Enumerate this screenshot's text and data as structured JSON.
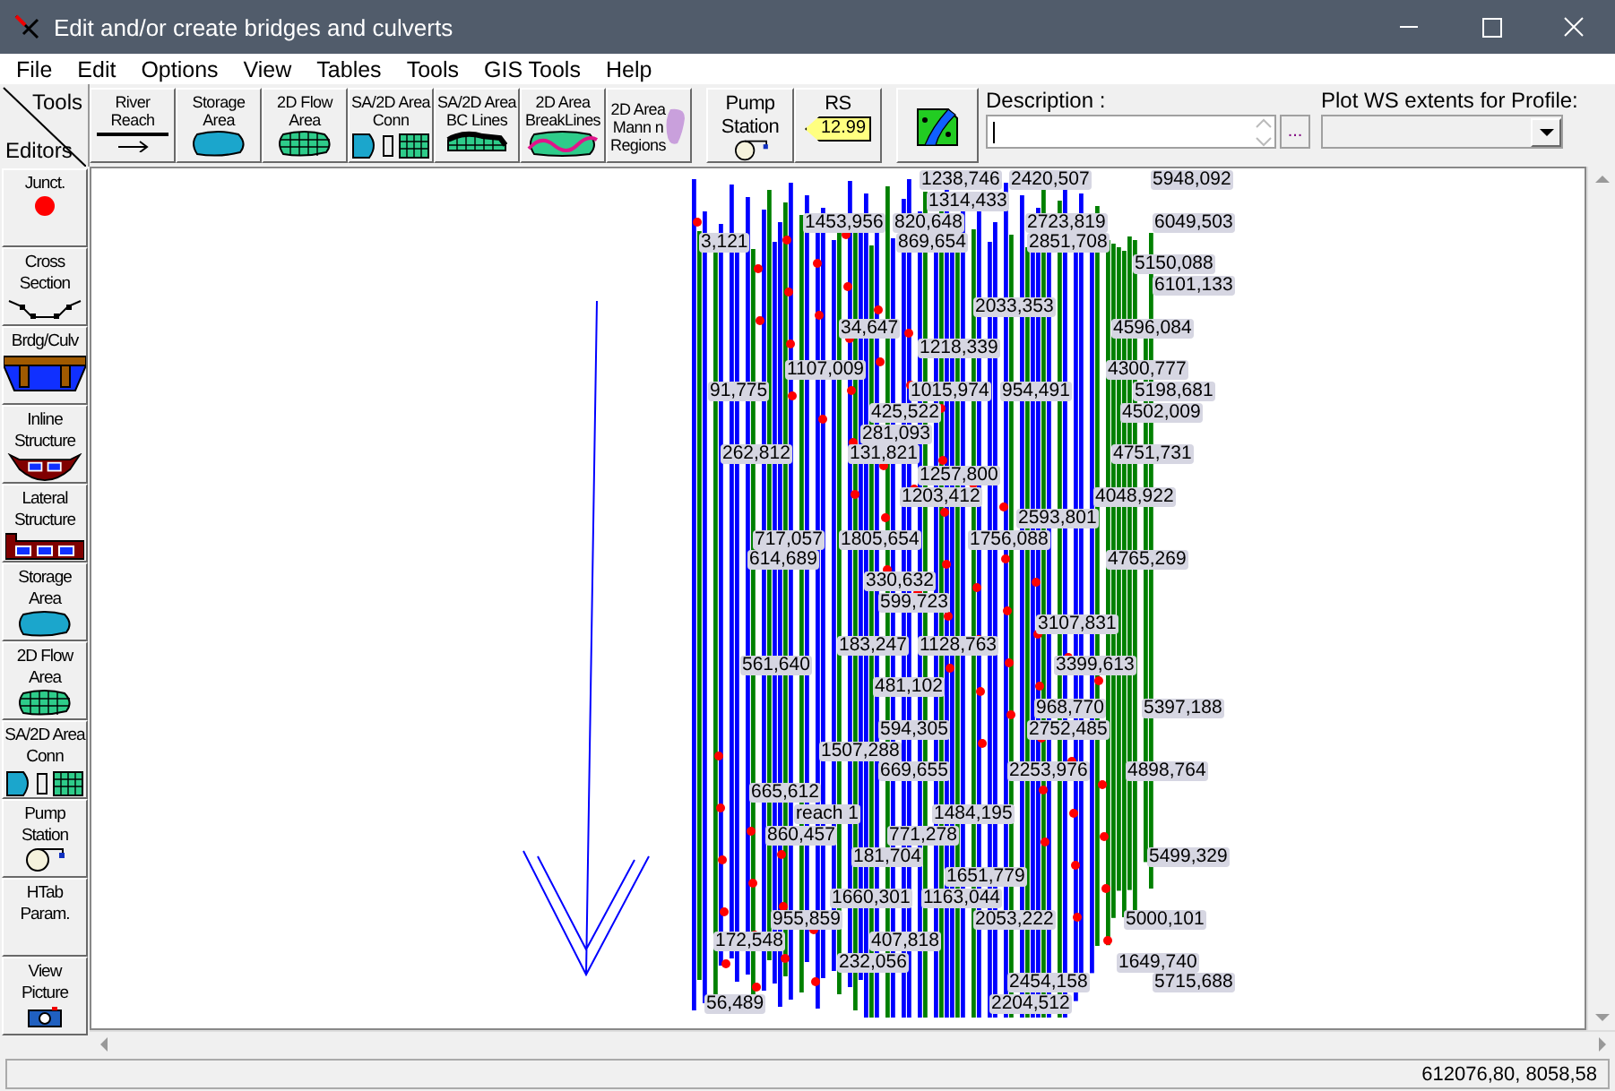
{
  "window": {
    "title": "Edit and/or create bridges and culverts"
  },
  "menu": [
    "File",
    "Edit",
    "Options",
    "View",
    "Tables",
    "Tools",
    "GIS Tools",
    "Help"
  ],
  "corner": {
    "top": "Tools",
    "bottom": "Editors"
  },
  "tools": [
    {
      "kind": "reach",
      "lines": [
        "River",
        "Reach"
      ]
    },
    {
      "kind": "storage",
      "lines": [
        "Storage",
        "Area"
      ]
    },
    {
      "kind": "flow2d",
      "lines": [
        "2D Flow",
        "Area"
      ]
    },
    {
      "kind": "conn",
      "lines": [
        "SA/2D Area",
        "Conn"
      ]
    },
    {
      "kind": "bclines",
      "lines": [
        "SA/2D Area",
        "BC Lines"
      ]
    },
    {
      "kind": "breaklines",
      "lines": [
        "2D Area",
        "BreakLines"
      ]
    },
    {
      "kind": "mann",
      "lines": [
        "2D Area",
        "Mann n",
        "Regions"
      ]
    }
  ],
  "tools2": [
    {
      "kind": "pump",
      "lines": [
        "Pump",
        "Station"
      ]
    },
    {
      "kind": "rs",
      "lines": [
        "RS"
      ],
      "tag": "12.99"
    },
    {
      "kind": "map"
    }
  ],
  "description": {
    "label": "Description :"
  },
  "more_button": "...",
  "profile": {
    "label": "Plot WS extents for Profile:"
  },
  "editors": [
    {
      "kind": "junction",
      "lines": [
        "Junct."
      ]
    },
    {
      "kind": "xs",
      "lines": [
        "Cross",
        "Section"
      ]
    },
    {
      "kind": "bridge",
      "lines": [
        "Brdg/Culv"
      ]
    },
    {
      "kind": "inline",
      "lines": [
        "Inline",
        "Structure"
      ]
    },
    {
      "kind": "lateral",
      "lines": [
        "Lateral",
        "Structure"
      ]
    },
    {
      "kind": "storage",
      "lines": [
        "Storage",
        "Area"
      ]
    },
    {
      "kind": "flow2d",
      "lines": [
        "2D Flow",
        "Area"
      ]
    },
    {
      "kind": "conn",
      "lines": [
        "SA/2D Area",
        "Conn"
      ]
    },
    {
      "kind": "pump",
      "lines": [
        "Pump",
        "Station"
      ]
    },
    {
      "kind": "none",
      "lines": [
        "HTab",
        "Param."
      ]
    },
    {
      "kind": "picture",
      "lines": [
        "View",
        "Picture"
      ]
    }
  ],
  "canvas": {
    "labels": [
      "1238,746",
      "2420,507",
      "5948,092",
      "1314,433",
      "1453,956",
      "820,648",
      "2723,819",
      "6049,503",
      "3,121",
      "869,654",
      "2851,708",
      "5150,088",
      "6101,133",
      "2033,353",
      "34,647",
      "4596,084",
      "1218,339",
      "1107,009",
      "4300,777",
      "91,775",
      "1015,974",
      "954,491",
      "5198,681",
      "425,522",
      "4502,009",
      "281,093",
      "262,812",
      "131,821",
      "4751,731",
      "1257,800",
      "1203,412",
      "4048,922",
      "2593,801",
      "717,057",
      "1805,654",
      "1756,088",
      "614,689",
      "4765,269",
      "330,632",
      "599,723",
      "3107,831",
      "183,247",
      "1128,763",
      "561,640",
      "3399,613",
      "481,102",
      "968,770",
      "5397,188",
      "594,305",
      "2752,485",
      "1507,288",
      "669,655",
      "2253,976",
      "4898,764",
      "665,612",
      "reach 1",
      "1484,195",
      "860,457",
      "771,278",
      "181,704",
      "5499,329",
      "1651,779",
      "1660,301",
      "1163,044",
      "955,859",
      "2053,222",
      "5000,101",
      "172,548",
      "407,818",
      "232,056",
      "1649,740",
      "2454,158",
      "5715,688",
      "56,489",
      "2204,512"
    ]
  },
  "status_bar": {
    "coordinates": "612076,80, 8058,58"
  }
}
